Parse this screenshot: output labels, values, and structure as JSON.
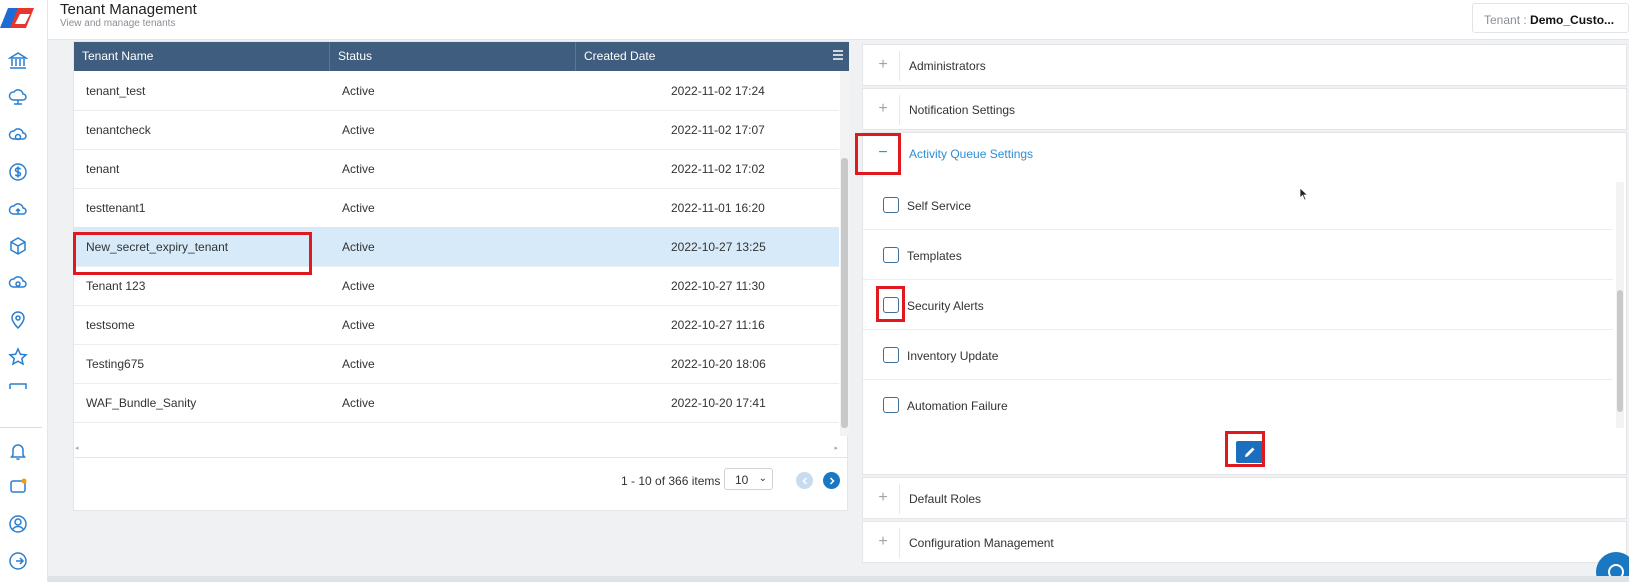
{
  "header": {
    "title": "Tenant Management",
    "subtitle": "View and manage tenants",
    "tenant_label": "Tenant : ",
    "tenant_value": "Demo_Custo..."
  },
  "sidebar": {
    "icons": [
      "bank-icon",
      "cloud-network-icon",
      "cloud-refresh-icon",
      "dollar-icon",
      "cloud-upload-icon",
      "cube-icon",
      "cloud-gear-icon",
      "user-location-icon",
      "star-icon",
      "bed-icon",
      "bell-icon",
      "chat-icon",
      "user-circle-icon",
      "logout-icon"
    ]
  },
  "grid": {
    "columns": [
      "Tenant Name",
      "Status",
      "Created Date"
    ],
    "rows": [
      {
        "name": "tenant_test",
        "status": "Active",
        "created": "2022-11-02 17:24"
      },
      {
        "name": "tenantcheck",
        "status": "Active",
        "created": "2022-11-02 17:07"
      },
      {
        "name": "tenant",
        "status": "Active",
        "created": "2022-11-02 17:02"
      },
      {
        "name": "testtenant1",
        "status": "Active",
        "created": "2022-11-01 16:20"
      },
      {
        "name": "New_secret_expiry_tenant",
        "status": "Active",
        "created": "2022-10-27 13:25"
      },
      {
        "name": "Tenant 123",
        "status": "Active",
        "created": "2022-10-27 11:30"
      },
      {
        "name": "testsome",
        "status": "Active",
        "created": "2022-10-27 11:16"
      },
      {
        "name": "Testing675",
        "status": "Active",
        "created": "2022-10-20 18:06"
      },
      {
        "name": "WAF_Bundle_Sanity",
        "status": "Active",
        "created": "2022-10-20 17:41"
      }
    ],
    "selected_row": 4,
    "pager_info": "1 - 10 of 366 items",
    "page_size": "10"
  },
  "accordion": {
    "sections": [
      {
        "title": "Administrators",
        "expanded": false
      },
      {
        "title": "Notification Settings",
        "expanded": false
      },
      {
        "title": "Activity Queue Settings",
        "expanded": true
      },
      {
        "title": "Default Roles",
        "expanded": false
      },
      {
        "title": "Configuration Management",
        "expanded": false
      }
    ],
    "activity_options": [
      {
        "label": "Self Service",
        "checked": false
      },
      {
        "label": "Templates",
        "checked": false
      },
      {
        "label": "Security Alerts",
        "checked": false
      },
      {
        "label": "Inventory Update",
        "checked": false
      },
      {
        "label": "Automation Failure",
        "checked": false
      }
    ]
  },
  "colors": {
    "grid_header": "#3f5d7e",
    "selected_row": "#d6eaf9",
    "accent": "#2a8fd6",
    "edit_button": "#1c6fbd",
    "highlight": "#e0191f"
  }
}
